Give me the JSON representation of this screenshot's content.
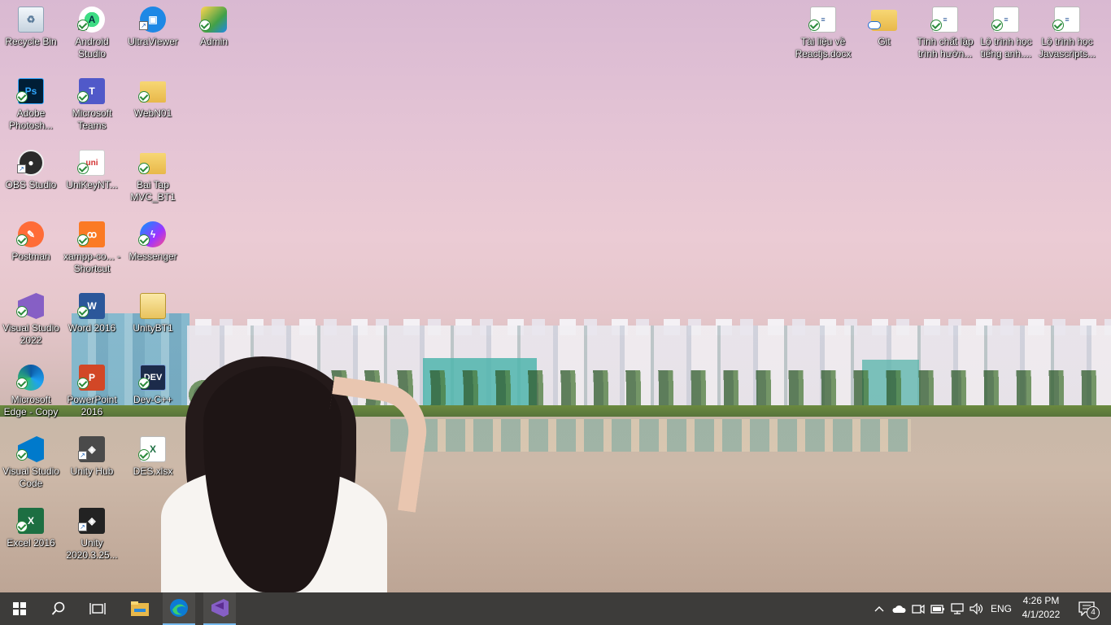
{
  "desktop": {
    "icons": [
      {
        "label": "Recycle Bin",
        "icon": "recycle-bin-icon",
        "glyph": "♻",
        "sync": "none",
        "shortcut": false
      },
      {
        "label": "Android Studio",
        "icon": "android-studio-icon",
        "glyph": "A",
        "sync": "check",
        "shortcut": true
      },
      {
        "label": "UltraViewer",
        "icon": "ultraviewer-icon",
        "glyph": "▣",
        "sync": "none",
        "shortcut": true
      },
      {
        "label": "Admin",
        "icon": "user-folder-icon",
        "glyph": "",
        "sync": "check",
        "shortcut": false
      },
      {
        "label": "Adobe Photosh...",
        "icon": "photoshop-icon",
        "glyph": "Ps",
        "sync": "check",
        "shortcut": false
      },
      {
        "label": "Microsoft Teams",
        "icon": "teams-icon",
        "glyph": "T",
        "sync": "check",
        "shortcut": false
      },
      {
        "label": "WebN01",
        "icon": "folder-icon",
        "glyph": "",
        "sync": "check",
        "shortcut": false
      },
      {
        "label": "OBS Studio",
        "icon": "obs-icon",
        "glyph": "●",
        "sync": "none",
        "shortcut": true
      },
      {
        "label": "UniKeyNT...",
        "icon": "unikey-icon",
        "glyph": "uni",
        "sync": "check",
        "shortcut": false
      },
      {
        "label": "Bai Tap MVC_BT1",
        "icon": "folder-icon",
        "glyph": "",
        "sync": "check",
        "shortcut": false
      },
      {
        "label": "Postman",
        "icon": "postman-icon",
        "glyph": "✎",
        "sync": "check",
        "shortcut": false
      },
      {
        "label": "xampp-co... - Shortcut",
        "icon": "xampp-icon",
        "glyph": "ꝏ",
        "sync": "check",
        "shortcut": false
      },
      {
        "label": "Messenger",
        "icon": "messenger-icon",
        "glyph": "ϟ",
        "sync": "check",
        "shortcut": false
      },
      {
        "label": "Visual Studio 2022",
        "icon": "visual-studio-icon",
        "glyph": "",
        "sync": "check",
        "shortcut": false
      },
      {
        "label": "Word 2016",
        "icon": "word-icon",
        "glyph": "W",
        "sync": "check",
        "shortcut": false
      },
      {
        "label": "UnityBT1",
        "icon": "folder-icon",
        "glyph": "",
        "sync": "none",
        "shortcut": false
      },
      {
        "label": "Microsoft Edge - Copy",
        "icon": "edge-icon",
        "glyph": "",
        "sync": "check",
        "shortcut": false
      },
      {
        "label": "PowerPoint 2016",
        "icon": "powerpoint-icon",
        "glyph": "P",
        "sync": "check",
        "shortcut": false
      },
      {
        "label": "Dev-C++",
        "icon": "devcpp-icon",
        "glyph": "DEV",
        "sync": "check",
        "shortcut": false
      },
      {
        "label": "Visual Studio Code",
        "icon": "vscode-icon",
        "glyph": "",
        "sync": "check",
        "shortcut": false
      },
      {
        "label": "Unity Hub",
        "icon": "unity-hub-icon",
        "glyph": "◈",
        "sync": "none",
        "shortcut": true
      },
      {
        "label": "DES.xlsx",
        "icon": "excel-file-icon",
        "glyph": "X",
        "sync": "check",
        "shortcut": false
      },
      {
        "label": "Excel 2016",
        "icon": "excel-icon",
        "glyph": "X",
        "sync": "check",
        "shortcut": false
      },
      {
        "label": "Unity 2020.3.25...",
        "icon": "unity-icon",
        "glyph": "◈",
        "sync": "none",
        "shortcut": true
      },
      {
        "label": "Tài liệu về Reactjs.docx",
        "icon": "document-icon",
        "glyph": "≡",
        "sync": "check",
        "shortcut": false
      },
      {
        "label": "Git",
        "icon": "folder-icon",
        "glyph": "",
        "sync": "cloud",
        "shortcut": false
      },
      {
        "label": "Tính chất lập trình hướn...",
        "icon": "document-icon",
        "glyph": "≡",
        "sync": "check",
        "shortcut": false
      },
      {
        "label": "Lộ trình học tiếng anh....",
        "icon": "document-icon",
        "glyph": "≡",
        "sync": "check",
        "shortcut": false
      },
      {
        "label": "Lộ trình học Javascripts...",
        "icon": "document-icon",
        "glyph": "≡",
        "sync": "check",
        "shortcut": false
      }
    ]
  },
  "taskbar": {
    "start": "start-icon",
    "search": "search-icon",
    "task_view": "task-view-icon",
    "pinned": [
      {
        "name": "file-explorer-icon",
        "active": false
      },
      {
        "name": "edge-icon",
        "active": true
      },
      {
        "name": "visual-studio-icon",
        "active": true
      }
    ],
    "tray": {
      "language": "ENG",
      "time": "4:26 PM",
      "date": "4/1/2022",
      "notification_count": "4"
    }
  },
  "colors": {
    "taskbar_bg": "#3d3c3a",
    "active_indicator": "#76b9ed"
  }
}
